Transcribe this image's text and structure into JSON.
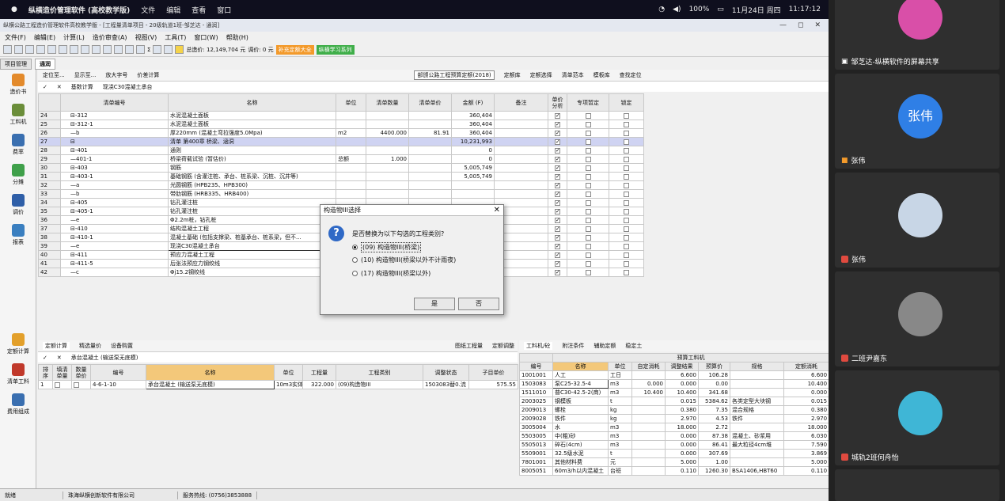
{
  "macbar": {
    "app": "纵横造价管理软件 (高校教学版)",
    "menus": [
      "文件",
      "编辑",
      "查看",
      "窗口"
    ],
    "battery": "100%",
    "date": "11月24日 周四",
    "time": "11:17:12"
  },
  "window": {
    "title": "纵横公路工程造价管理软件高校教学版 - [工程量清单项目 - 20级轨道1班-邹芝达 - 通润]",
    "controls": [
      "—",
      "◻",
      "✕"
    ]
  },
  "menu": [
    "文件(F)",
    "编辑(E)",
    "计算(L)",
    "造价审查(A)",
    "视图(V)",
    "工具(T)",
    "窗口(W)",
    "帮助(H)"
  ],
  "toolbar": {
    "sigma": "Σ",
    "total": "总造价: 12,149,704 元",
    "adjust": "调价: 0 元",
    "btn_orange": "补充定额大全",
    "btn_green": "纵横学习系列"
  },
  "tabs": [
    "项目管理",
    "通润"
  ],
  "left_nav": [
    "造价书",
    "工料机",
    "费率",
    "分摊",
    "调价",
    "报表"
  ],
  "left_nav2": [
    "定额计算",
    "清单工料",
    "费用组成"
  ],
  "subtoolbar": {
    "items": [
      "定位至...",
      "显示至...",
      "放大字号",
      "价差计算"
    ],
    "quota": "部颁公路工程预算定额(2018)",
    "right": [
      "定额库",
      "定额选择",
      "清单范本",
      "模板库",
      "查找定位"
    ]
  },
  "edit_row": {
    "calc": "基数计算",
    "text": "现浇C30混凝土承台"
  },
  "table": {
    "headers": [
      "清单编号",
      "名称",
      "单位",
      "清单数量",
      "清单单价",
      "金额 (F)",
      "备注",
      "单价分析",
      "专项暂定",
      "锁定"
    ],
    "rows": [
      {
        "n": "24",
        "code": "⊟-312",
        "name": "水泥混凝土面板",
        "unit": "",
        "qty": "",
        "price": "",
        "amt": "360,404",
        "a": 1,
        "b": 0,
        "c": 0,
        "hl": 0
      },
      {
        "n": "25",
        "code": "⊟-312-1",
        "name": "水泥混凝土面板",
        "unit": "",
        "qty": "",
        "price": "",
        "amt": "360,404",
        "a": 1,
        "b": 0,
        "c": 0,
        "hl": 0
      },
      {
        "n": "26",
        "code": "—b",
        "name": "厚220mm (混凝土弯拉强度5.0Mpa)",
        "unit": "m2",
        "qty": "4400.000",
        "price": "81.91",
        "amt": "360,404",
        "a": 1,
        "b": 0,
        "c": 0,
        "hl": 0
      },
      {
        "n": "27",
        "code": "⊟",
        "name": "清单 第400章  桥梁、涵洞",
        "unit": "",
        "qty": "",
        "price": "",
        "amt": "10,231,993",
        "a": 1,
        "b": 0,
        "c": 0,
        "hl": 1
      },
      {
        "n": "28",
        "code": "⊟-401",
        "name": "通则",
        "unit": "",
        "qty": "",
        "price": "",
        "amt": "0",
        "a": 1,
        "b": 0,
        "c": 0,
        "hl": 0
      },
      {
        "n": "29",
        "code": "—401-1",
        "name": "桥梁荷载试验 (暂估价)",
        "unit": "总额",
        "qty": "1.000",
        "price": "",
        "amt": "0",
        "a": 1,
        "b": 0,
        "c": 0,
        "hl": 0
      },
      {
        "n": "30",
        "code": "⊟-403",
        "name": "钢筋",
        "unit": "",
        "qty": "",
        "price": "",
        "amt": "5,005,749",
        "a": 1,
        "b": 0,
        "c": 0,
        "hl": 0
      },
      {
        "n": "31",
        "code": "⊟-403-1",
        "name": "基础钢筋 (含灌注桩、承台、桩系梁、沉桩、沉井等)",
        "unit": "",
        "qty": "",
        "price": "",
        "amt": "5,005,749",
        "a": 1,
        "b": 0,
        "c": 0,
        "hl": 0
      },
      {
        "n": "32",
        "code": "—a",
        "name": "光圆钢筋 (HPB235、HPB300)",
        "unit": "",
        "qty": "",
        "price": "",
        "amt": "",
        "a": 1,
        "b": 0,
        "c": 0,
        "hl": 0
      },
      {
        "n": "33",
        "code": "—b",
        "name": "带肋钢筋 (HRB335、HRB400)",
        "unit": "",
        "qty": "",
        "price": "",
        "amt": "",
        "a": 1,
        "b": 0,
        "c": 0,
        "hl": 0
      },
      {
        "n": "34",
        "code": "⊟-405",
        "name": "钻孔灌注桩",
        "unit": "",
        "qty": "",
        "price": "",
        "amt": "",
        "a": 1,
        "b": 0,
        "c": 0,
        "hl": 0
      },
      {
        "n": "35",
        "code": "⊟-405-1",
        "name": "钻孔灌注桩",
        "unit": "",
        "qty": "",
        "price": "",
        "amt": "",
        "a": 1,
        "b": 0,
        "c": 0,
        "hl": 0
      },
      {
        "n": "36",
        "code": "—e",
        "name": "Φ2.2m桩，钻孔桩",
        "unit": "",
        "qty": "",
        "price": "",
        "amt": "",
        "a": 1,
        "b": 0,
        "c": 0,
        "hl": 0
      },
      {
        "n": "37",
        "code": "⊟-410",
        "name": "结构混凝土工程",
        "unit": "",
        "qty": "",
        "price": "",
        "amt": "",
        "a": 1,
        "b": 0,
        "c": 0,
        "hl": 0
      },
      {
        "n": "38",
        "code": "⊟-410-1",
        "name": "混凝土基础 (包括支撑梁、桩基承台、桩系梁，但不...",
        "unit": "",
        "qty": "",
        "price": "",
        "amt": "",
        "a": 1,
        "b": 0,
        "c": 0,
        "hl": 0
      },
      {
        "n": "39",
        "code": "—e",
        "name": "现浇C30混凝土承台",
        "unit": "",
        "qty": "",
        "price": "",
        "amt": "",
        "a": 1,
        "b": 0,
        "c": 0,
        "hl": 0
      },
      {
        "n": "40",
        "code": "⊟-411",
        "name": "预应力混凝土工程",
        "unit": "",
        "qty": "",
        "price": "",
        "amt": "",
        "a": 1,
        "b": 0,
        "c": 0,
        "hl": 0
      },
      {
        "n": "41",
        "code": "⊟-411-5",
        "name": "后张法预应力钢绞线",
        "unit": "",
        "qty": "",
        "price": "",
        "amt": "",
        "a": 1,
        "b": 0,
        "c": 0,
        "hl": 0
      },
      {
        "n": "42",
        "code": "—c",
        "name": "Φj15.2钢绞线",
        "unit": "",
        "qty": "",
        "price": "",
        "amt": "",
        "a": 1,
        "b": 0,
        "c": 0,
        "hl": 0
      }
    ]
  },
  "dialog": {
    "title": "构造物III选择",
    "question": "是否替换为以下勾选的工程类别?",
    "options": [
      "(09) 构造物III(桥梁)",
      "(10) 构造物III(桥梁以外不计雨夜)",
      "(17) 构造物III(桥梁以外)"
    ],
    "yes": "是",
    "no": "否"
  },
  "bottom_tabs": [
    "定额计算",
    "精选量价",
    "设备购置"
  ],
  "bottom_right_tabs": [
    "图纸工程量",
    "定额调整"
  ],
  "bottom_edit": "承台混凝土 (输送泵无底模)",
  "quota_table": {
    "headers": [
      "排序",
      "填清单量",
      "数量单价",
      "编号",
      "名称",
      "单位",
      "工程量",
      "工程类别",
      "调整状态",
      "子目单价"
    ],
    "rows": [
      {
        "n": "1",
        "code": "4-6-1-10",
        "name": "承台混凝土 (输送泵无底模)",
        "unit": "10m3实体",
        "qty": "322.000",
        "type": "(09)构造物III",
        "adj": "1503083替0.流",
        "price": "575.55"
      }
    ]
  },
  "mat_tabs": [
    "工料机/砼",
    "附注条件",
    "辅助定额",
    "稳定土"
  ],
  "mat_table": {
    "group": "预算工料机",
    "headers": [
      "编号",
      "名称",
      "单位",
      "自定消耗",
      "调整结果",
      "预算价",
      "规格",
      "定额消耗"
    ],
    "rows": [
      {
        "code": "1001001",
        "name": "人工",
        "unit": "工日",
        "cust": "",
        "res": "6.600",
        "price": "106.28",
        "spec": "",
        "q": "6.600"
      },
      {
        "code": "1503083",
        "name": "泵C25-32.5-4",
        "unit": "m3",
        "cust": "0.000",
        "res": "0.000",
        "price": "0.00",
        "spec": "",
        "q": "10.400"
      },
      {
        "code": "1511010",
        "name": "普C30-42.5-2(商)",
        "unit": "m3",
        "cust": "10.400",
        "res": "10.400",
        "price": "341.68",
        "spec": "",
        "q": "0.000"
      },
      {
        "code": "2003025",
        "name": "钢模板",
        "unit": "t",
        "cust": "",
        "res": "0.015",
        "price": "5384.62",
        "spec": "各类定型大块钢",
        "q": "0.015"
      },
      {
        "code": "2009013",
        "name": "螺栓",
        "unit": "kg",
        "cust": "",
        "res": "0.380",
        "price": "7.35",
        "spec": "混合规格",
        "q": "0.380"
      },
      {
        "code": "2009028",
        "name": "铁件",
        "unit": "kg",
        "cust": "",
        "res": "2.970",
        "price": "4.53",
        "spec": "铁件",
        "q": "2.970"
      },
      {
        "code": "3005004",
        "name": "水",
        "unit": "m3",
        "cust": "",
        "res": "18.000",
        "price": "2.72",
        "spec": "",
        "q": "18.000"
      },
      {
        "code": "5503005",
        "name": "中(粗)砂",
        "unit": "m3",
        "cust": "",
        "res": "0.000",
        "price": "87.38",
        "spec": "混凝土、砂浆用",
        "q": "6.030"
      },
      {
        "code": "5505013",
        "name": "碎石(4cm)",
        "unit": "m3",
        "cust": "",
        "res": "0.000",
        "price": "86.41",
        "spec": "最大粒径4cm堆",
        "q": "7.590"
      },
      {
        "code": "5509001",
        "name": "32.5级水泥",
        "unit": "t",
        "cust": "",
        "res": "0.000",
        "price": "307.69",
        "spec": "",
        "q": "3.869"
      },
      {
        "code": "7801001",
        "name": "其他材料费",
        "unit": "元",
        "cust": "",
        "res": "5.000",
        "price": "1.00",
        "spec": "",
        "q": "5.000"
      },
      {
        "code": "8005051",
        "name": "60m3/h以内混凝土",
        "unit": "台班",
        "cust": "",
        "res": "0.110",
        "price": "1260.30",
        "spec": "BSA1406,HBT60",
        "q": "0.110"
      }
    ]
  },
  "status": [
    "就绪",
    "珠海纵横创新软件有限公司",
    "服务热线: (0756)3853888"
  ],
  "participants": [
    {
      "name": "邹芝达-纵横软件的屏幕共享",
      "color": "#d94fa8"
    },
    {
      "name": "张伟",
      "initials": "张伟",
      "color": "#2f7fe6"
    },
    {
      "name": "张伟",
      "color": "#c8d6e6"
    },
    {
      "name": "二班尹嘉东",
      "color": "#888"
    },
    {
      "name": "城轨2班何舟怡",
      "color": "#3fb6d6"
    }
  ]
}
